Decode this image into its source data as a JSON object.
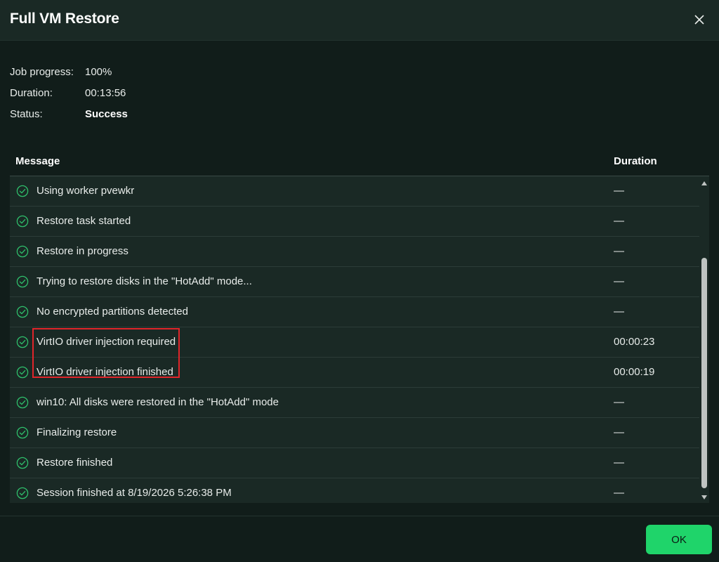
{
  "dialog": {
    "title": "Full VM Restore"
  },
  "summary": [
    {
      "label": "Job progress:",
      "value": "100%",
      "bold": false
    },
    {
      "label": "Duration:",
      "value": "00:13:56",
      "bold": false
    },
    {
      "label": "Status:",
      "value": "Success",
      "bold": true
    }
  ],
  "table": {
    "headers": {
      "message": "Message",
      "duration": "Duration"
    },
    "rows": [
      {
        "status": "success",
        "message": "Using worker pvewkr",
        "duration": "—"
      },
      {
        "status": "success",
        "message": "Restore task started",
        "duration": "—"
      },
      {
        "status": "success",
        "message": "Restore in progress",
        "duration": "—"
      },
      {
        "status": "success",
        "message": "Trying to restore disks in the \"HotAdd\" mode...",
        "duration": "—"
      },
      {
        "status": "success",
        "message": "No encrypted partitions detected",
        "duration": "—"
      },
      {
        "status": "success",
        "message": "VirtIO driver injection required",
        "duration": "00:00:23"
      },
      {
        "status": "success",
        "message": "VirtIO driver injection finished",
        "duration": "00:00:19"
      },
      {
        "status": "success",
        "message": "win10: All disks were restored in the \"HotAdd\" mode",
        "duration": "—"
      },
      {
        "status": "success",
        "message": "Finalizing restore",
        "duration": "—"
      },
      {
        "status": "success",
        "message": "Restore finished",
        "duration": "—"
      },
      {
        "status": "success",
        "message": "Session finished at 8/19/2026 5:26:38 PM",
        "duration": "—"
      }
    ]
  },
  "buttons": {
    "ok": "OK"
  },
  "colors": {
    "success": "#2fbf6b",
    "accent": "#1fd46a",
    "highlight": "#e0252a"
  },
  "icons": {
    "close": "close-icon",
    "row_status": "check-circle-icon"
  }
}
